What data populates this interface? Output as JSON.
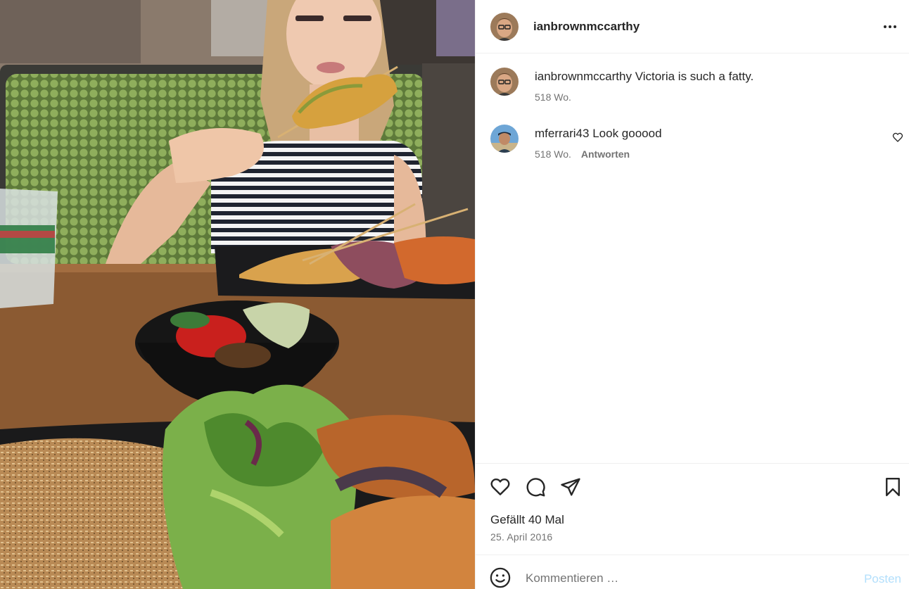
{
  "post": {
    "author": "ianbrownmccarthy",
    "image_alt": "Food photo at restaurant"
  },
  "comments": [
    {
      "username": "ianbrownmccarthy",
      "text": "Victoria is such a fatty.",
      "age": "518 Wo.",
      "reply_label": ""
    },
    {
      "username": "mferrari43",
      "text": "Look gooood",
      "age": "518 Wo.",
      "reply_label": "Antworten"
    }
  ],
  "stats": {
    "likes": "Gefällt 40 Mal",
    "date": "25. April 2016"
  },
  "composer": {
    "placeholder": "Kommentieren …",
    "post_label": "Posten"
  },
  "colors": {
    "text": "#262626",
    "muted": "#737373",
    "post_disabled": "#b2dffc",
    "divider": "#efefef"
  },
  "icons": [
    "more-options-icon",
    "heart-icon",
    "comment-icon",
    "share-icon",
    "bookmark-icon",
    "emoji-icon",
    "like-comment-icon"
  ]
}
